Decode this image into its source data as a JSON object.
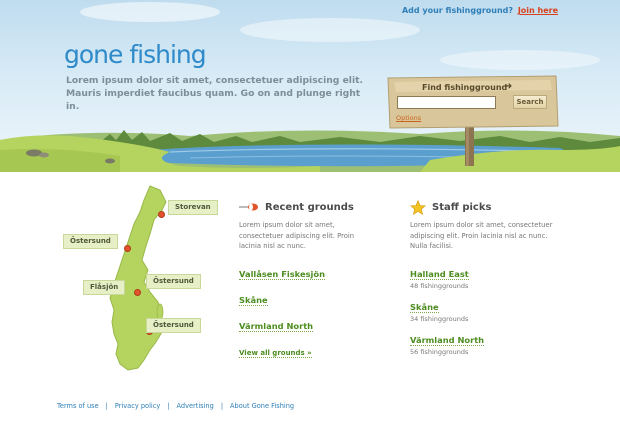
{
  "top_bar": {
    "prompt": "Add your fishingground?",
    "join_link": "Join here"
  },
  "logo": {
    "text": "gone fishing"
  },
  "tagline": {
    "line1": "Lorem ipsum dolor sit amet, consectetuer adipiscing elit.",
    "line2": "Mauris imperdiet faucibus quam. Go on and plunge right in."
  },
  "search": {
    "title": "Find fishingground",
    "value": "",
    "button": "Search",
    "options": "Options"
  },
  "map": {
    "labels": {
      "storevan": "Storevan",
      "ostersund_west": "Östersund",
      "flasjon": "Flåsjön",
      "ostersund_mid": "Östersund",
      "ostersund_south": "Östersund"
    }
  },
  "recent": {
    "heading": "Recent grounds",
    "intro": "Lorem ipsum dolor sit amet, consectetuer adipiscing elit. Proin lacinia nisl ac nunc.",
    "items": [
      "Vallåsen Fiskesjön",
      "Skåne",
      "Värmland North"
    ],
    "view_all": "View all grounds »"
  },
  "staff": {
    "heading": "Staff picks",
    "intro": "Lorem ipsum dolor sit amet, consectetuer adipiscing elit. Proin lacinia nisl ac nunc. Nulla facilisi.",
    "items": [
      {
        "name": "Halland East",
        "count": "48 fishinggrounds"
      },
      {
        "name": "Skåne",
        "count": "34 fishinggrounds"
      },
      {
        "name": "Värmland North",
        "count": "56 fishinggrounds"
      }
    ]
  },
  "footer": {
    "links": [
      "Terms of use",
      "Privacy policy",
      "Advertising",
      "About Gone Fishing"
    ]
  },
  "colors": {
    "brand_blue": "#2e8ac9",
    "link_green": "#4d8d20",
    "accent_red": "#d8411c",
    "map_green": "#b4d35f"
  }
}
